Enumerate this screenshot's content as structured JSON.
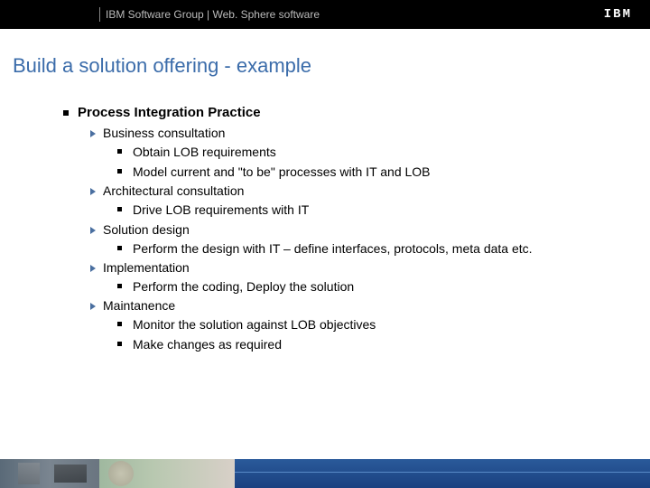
{
  "header": {
    "group_text": "IBM Software Group | Web. Sphere software",
    "logo_text": "IBM"
  },
  "title": "Build a solution offering - example",
  "outline": {
    "heading": "Process Integration Practice",
    "items": [
      {
        "label": "Business consultation",
        "sub": [
          "Obtain LOB requirements",
          "Model current and \"to be\" processes with IT and LOB"
        ]
      },
      {
        "label": "Architectural consultation",
        "sub": [
          "Drive LOB requirements with IT"
        ]
      },
      {
        "label": "Solution design",
        "sub": [
          "Perform the design with IT – define interfaces, protocols, meta data etc."
        ]
      },
      {
        "label": "Implementation",
        "sub": [
          "Perform the coding, Deploy the solution"
        ]
      },
      {
        "label": "Maintanence",
        "sub": [
          "Monitor the solution against LOB objectives",
          "Make changes as required"
        ]
      }
    ]
  }
}
